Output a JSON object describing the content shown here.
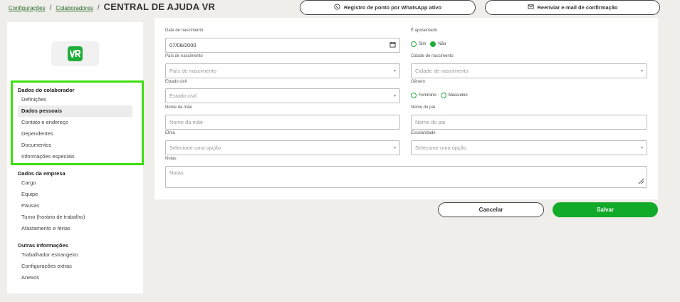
{
  "breadcrumb": {
    "items": [
      "Configurações",
      "Colaboradores"
    ],
    "separator": "/",
    "title": "CENTRAL DE AJUDA VR"
  },
  "top_actions": {
    "whatsapp_label": "Registro de ponto por WhatsApp ativo",
    "email_label": "Reenviar e-mail de confirmação"
  },
  "sidebar": {
    "logo_text": "VR",
    "groups": [
      {
        "title": "Dados do colaborador",
        "items": [
          "Definições",
          "Dados pessoais",
          "Contato e endereço",
          "Dependentes",
          "Documentos",
          "Informações especiais"
        ]
      },
      {
        "title": "Dados da empresa",
        "items": [
          "Cargo",
          "Equipe",
          "Pausas",
          "Turno (horário de trabalho)",
          "Afastamento e férias"
        ]
      },
      {
        "title": "Outras informações",
        "items": [
          "Trabalhador estrangeiro",
          "Configurações extras",
          "Anexos"
        ]
      }
    ],
    "active_item": "Dados pessoais"
  },
  "form": {
    "birth_date": {
      "label": "Data de nascimento",
      "value": "07/08/2000"
    },
    "retired": {
      "label": "É aposentado",
      "options": [
        "Sim",
        "Não"
      ],
      "selected": "Não"
    },
    "birth_country": {
      "label": "País de nascimento",
      "placeholder": "País de nascimento"
    },
    "birth_city": {
      "label": "Cidade de nascimento",
      "placeholder": "Cidade de nascimento"
    },
    "marital_status": {
      "label": "Estado civil",
      "placeholder": "Estado civil"
    },
    "gender": {
      "label": "Gênero",
      "options": [
        "Feminino",
        "Masculino"
      ],
      "selected": ""
    },
    "mother_name": {
      "label": "Nome da mãe",
      "placeholder": "Nome da mãe"
    },
    "father_name": {
      "label": "Nome do pai",
      "placeholder": "Nome do pai"
    },
    "ethnicity": {
      "label": "Etnia",
      "placeholder": "Selecione uma opção"
    },
    "education": {
      "label": "Escolaridade",
      "placeholder": "Selecione uma opção"
    },
    "notes": {
      "label": "Notas",
      "placeholder": "Notas"
    }
  },
  "actions": {
    "cancel_label": "Cancelar",
    "save_label": "Salvar"
  },
  "colors": {
    "brand_green": "#1fae3a",
    "save_green": "#11aa29",
    "highlight": "#3de00f"
  }
}
